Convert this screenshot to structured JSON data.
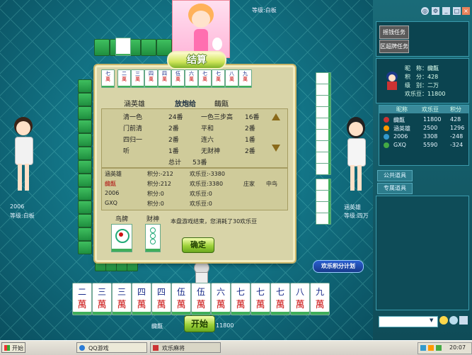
{
  "top": {
    "level_label": "等级:白板"
  },
  "banner": {
    "title": "结算"
  },
  "dialog": {
    "winner": "涵英雄",
    "fangpao_label": "放炮给",
    "loser": "齱齀",
    "fan_rows": [
      {
        "name": "清一色",
        "value": "24番",
        "name2": "一色三步高",
        "value2": "16番"
      },
      {
        "name": "门前清",
        "value": "2番",
        "name2": "平和",
        "value2": "2番"
      },
      {
        "name": "四归一",
        "value": "2番",
        "name2": "连六",
        "value2": "1番"
      },
      {
        "name": "听",
        "value": "1番",
        "name2": "无财神",
        "value2": "2番"
      }
    ],
    "total_label": "总计",
    "total_value": "53番",
    "scores": [
      {
        "name": "涵英雄",
        "points": "积分:-212",
        "beans": "欢乐豆:-3380",
        "role": "",
        "extra": ""
      },
      {
        "name": "齱齀",
        "points": "积分:212",
        "beans": "欢乐豆:3380",
        "role": "庄家",
        "extra": "中鸟"
      },
      {
        "name": "2006",
        "points": "积分:0",
        "beans": "欢乐豆:0",
        "role": "",
        "extra": ""
      },
      {
        "name": "GXQ",
        "points": "积分:0",
        "beans": "欢乐豆:0",
        "role": "",
        "extra": ""
      }
    ],
    "bird_label": "鸟牌",
    "caishen_label": "财神",
    "notice": "本盘游戏结束，您消耗了30欢乐豆",
    "confirm_label": "确定"
  },
  "hand_tiles": [
    {
      "top": "二",
      "bot": "萬"
    },
    {
      "top": "三",
      "bot": "萬"
    },
    {
      "top": "三",
      "bot": "萬"
    },
    {
      "top": "四",
      "bot": "萬"
    },
    {
      "top": "四",
      "bot": "萬"
    },
    {
      "top": "伍",
      "bot": "萬"
    },
    {
      "top": "伍",
      "bot": "萬"
    },
    {
      "top": "六",
      "bot": "萬"
    },
    {
      "top": "七",
      "bot": "萬"
    },
    {
      "top": "七",
      "bot": "萬"
    },
    {
      "top": "七",
      "bot": "萬"
    },
    {
      "top": "八",
      "bot": "萬"
    },
    {
      "top": "九",
      "bot": "萬"
    }
  ],
  "winning_hand": [
    "七",
    "二",
    "三",
    "四",
    "四",
    "伍",
    "六",
    "七",
    "七",
    "八",
    "九"
  ],
  "players": {
    "left": {
      "name": "2006",
      "level": "等级:白板"
    },
    "right": {
      "name": "涵英雄",
      "level": "等级:四万"
    },
    "bottom": {
      "name": "齱齀",
      "beans": "11800"
    }
  },
  "start_label": "开始",
  "panel": {
    "quest1": "摇钱任务",
    "quest2": "区超牌任务",
    "info": {
      "nick": "昵　称：齱齀",
      "points": "积　分：428",
      "level": "级　别：二万",
      "beans": "欢乐豆：11800"
    },
    "table_headers": [
      "昵称",
      "欢乐豆",
      "积分"
    ],
    "table_rows": [
      {
        "name": "齱齀",
        "beans": "11800",
        "points": "428"
      },
      {
        "name": "涵英雄",
        "beans": "2500",
        "points": "1296"
      },
      {
        "name": "2006",
        "beans": "3308",
        "points": "-248"
      },
      {
        "name": "GXQ",
        "beans": "5590",
        "points": "-324"
      }
    ],
    "tab_public": "公共道具",
    "tab_private": "专属道具",
    "plan_label": "欢乐积分计划"
  },
  "taskbar": {
    "start": "开始",
    "task1": "QQ游戏",
    "task2": "欢乐麻将",
    "clock": "20:07"
  },
  "colors": {
    "accent_green": "#3fae5a",
    "tile_red": "#cc1111",
    "tile_blue": "#1a2c8a"
  }
}
